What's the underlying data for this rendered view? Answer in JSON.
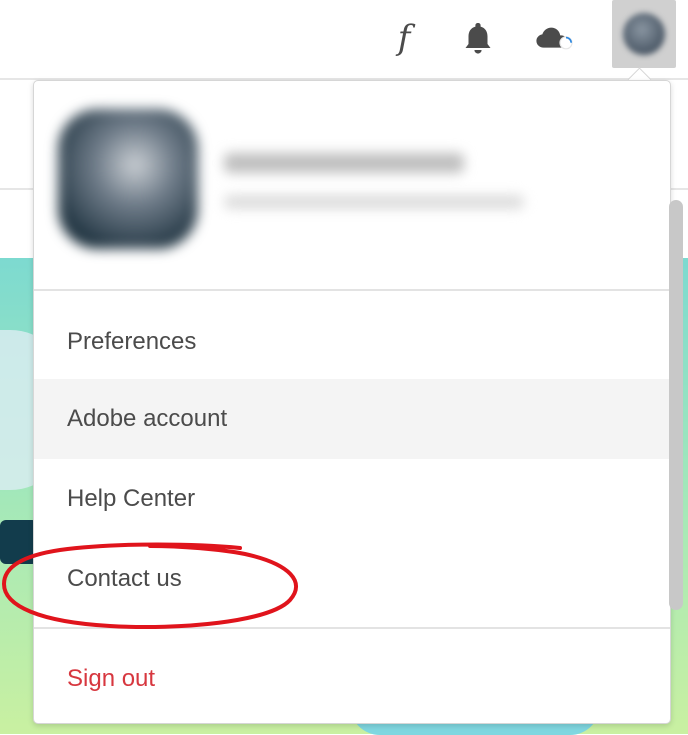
{
  "topbar": {
    "fonts_glyph": "f",
    "icons": [
      "fonts-icon",
      "bell-icon",
      "cloud-sync-icon",
      "avatar"
    ]
  },
  "menu": {
    "items": [
      {
        "label": "Preferences"
      },
      {
        "label": "Adobe account"
      },
      {
        "label": "Help Center"
      },
      {
        "label": "Contact us"
      }
    ],
    "sign_out": "Sign out",
    "hovered_item": "Adobe account",
    "highlighted_item": "Contact us"
  },
  "colors": {
    "sign_out": "#d7373f",
    "annotation": "#e0141c",
    "hover_bg": "#f4f4f4"
  }
}
